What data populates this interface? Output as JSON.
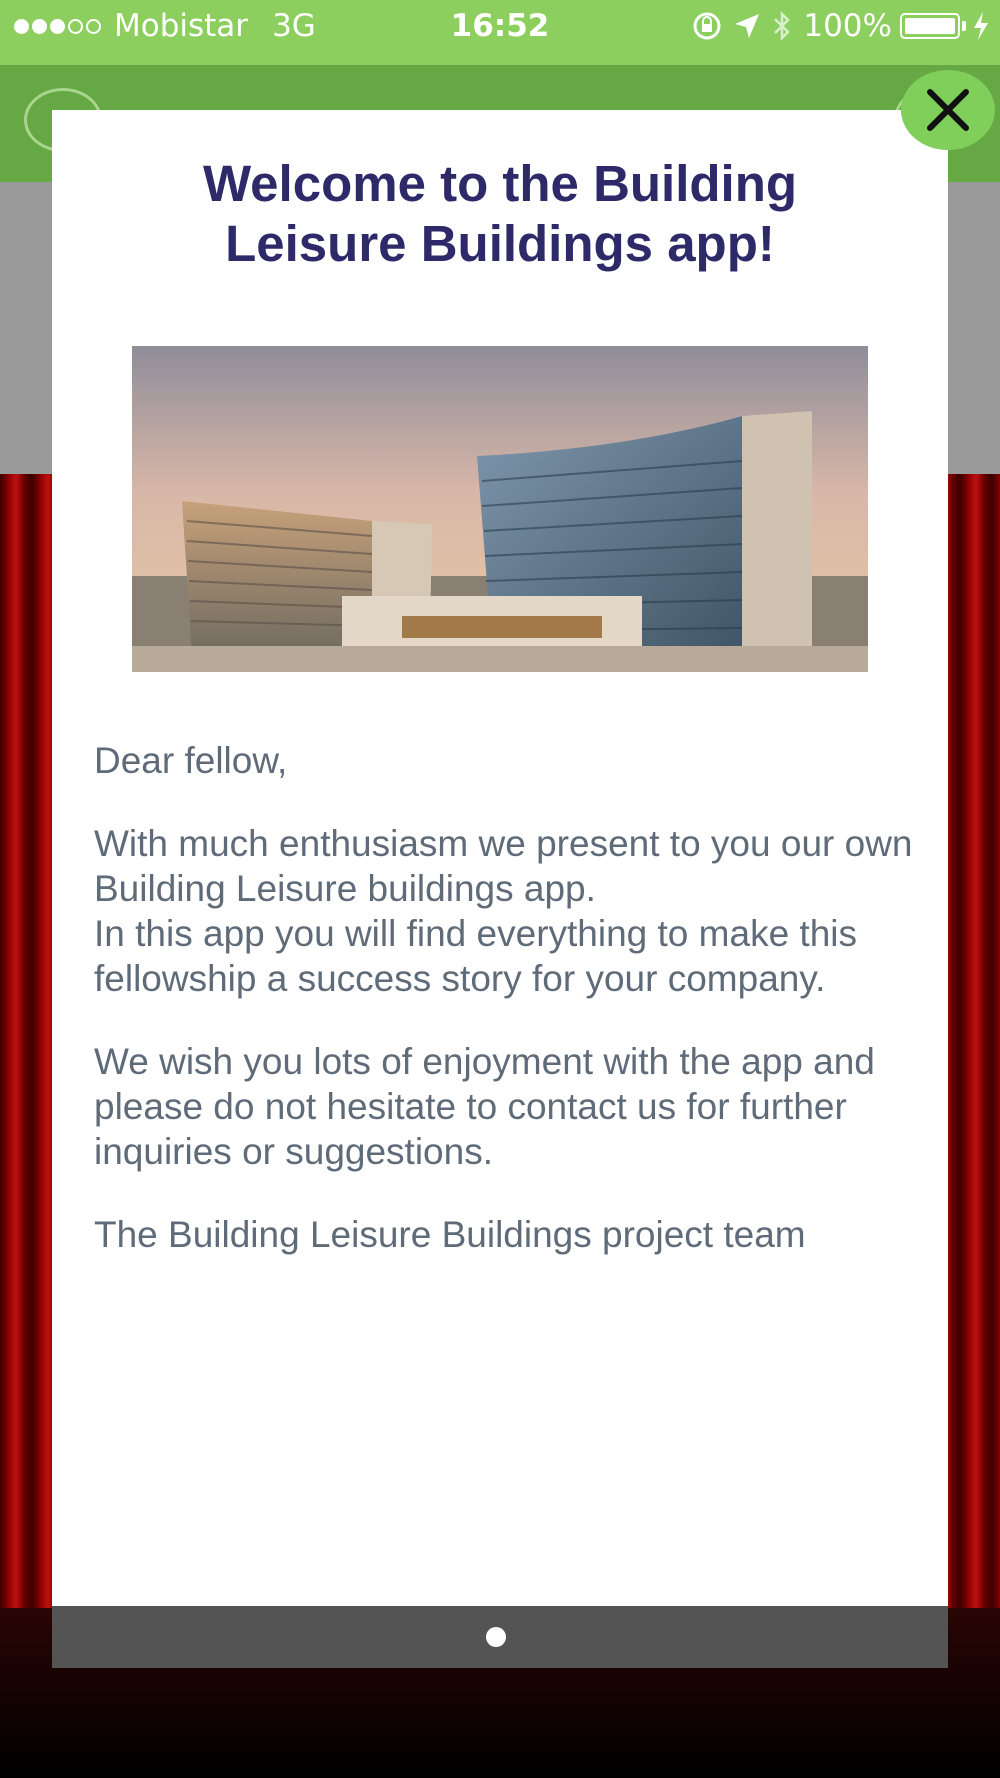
{
  "status_bar": {
    "carrier": "Mobistar",
    "network": "3G",
    "time": "16:52",
    "battery": "100%"
  },
  "modal": {
    "title_line1": "Welcome to the Building",
    "title_line2": "Leisure Buildings app!",
    "paragraphs": {
      "greeting": "Dear fellow,",
      "intro": "With much enthusiasm we present to you our own Building Leisure buildings app.",
      "intro2": "In this app you will find everything to make this fellowship a success story for your company.",
      "wish": "We wish you lots of enjoyment with the app and please do not hesitate to contact us for further inquiries or suggestions.",
      "signature": "The Building Leisure Buildings project team"
    },
    "page_indicator": {
      "current": 1,
      "total": 1
    }
  },
  "colors": {
    "status_bar": "#8ccf5f",
    "header": "#66a844",
    "title": "#2e2a6a",
    "body_text": "#5f6b78",
    "footer": "#545454",
    "close_button": "#7fcf5a"
  },
  "icons": {
    "close": "close-icon",
    "menu": "menu-icon",
    "location": "location-arrow-icon",
    "bluetooth": "bluetooth-icon",
    "rotation_lock": "rotation-lock-icon",
    "charging": "charging-icon"
  }
}
